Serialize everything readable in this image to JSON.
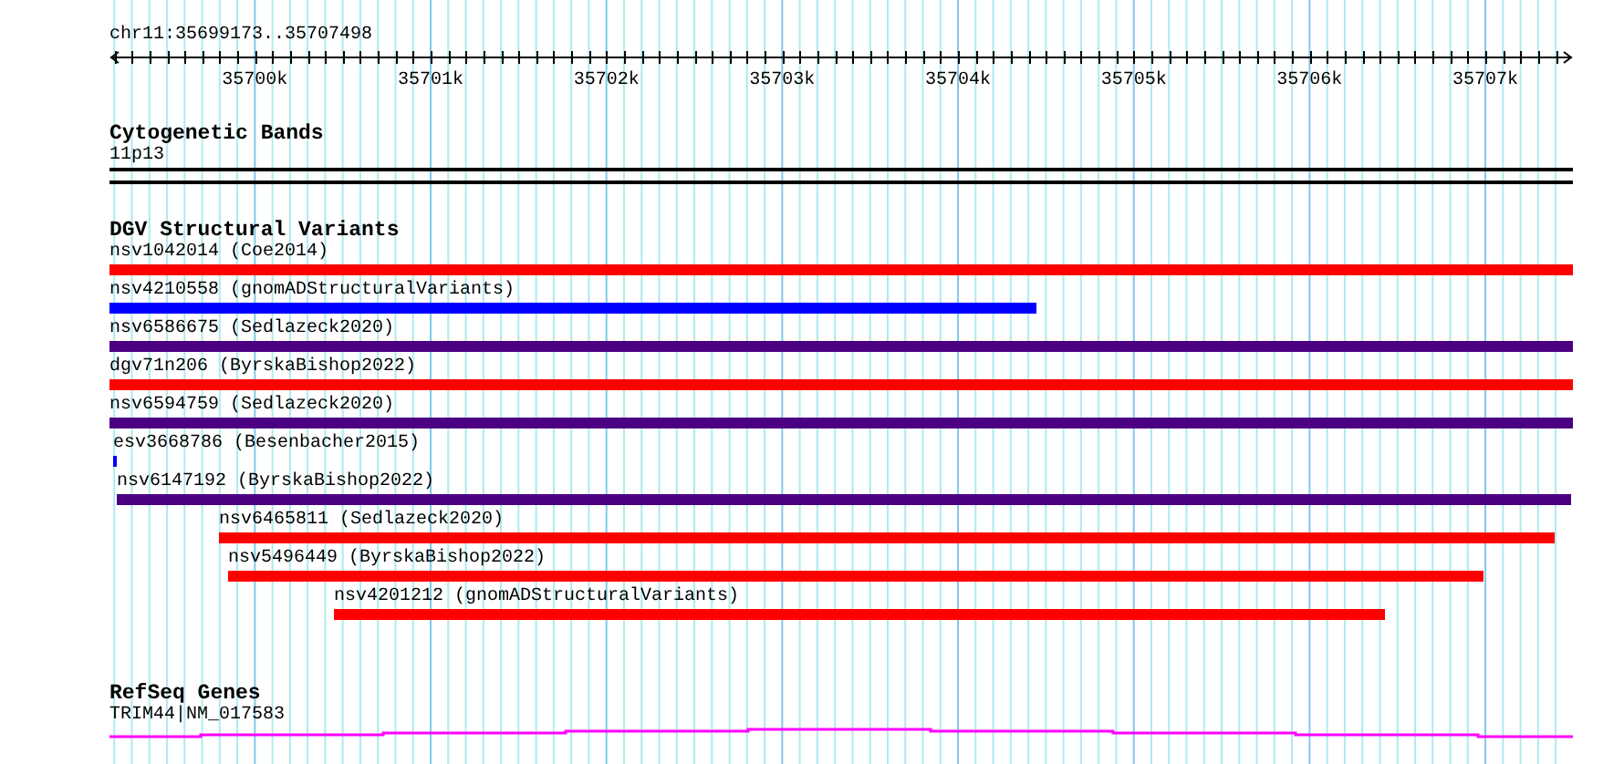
{
  "ruler": {
    "location": "chr11:35699173..35707498",
    "ticks": [
      "35700k",
      "35701k",
      "35702k",
      "35703k",
      "35704k",
      "35705k",
      "35706k",
      "35707k"
    ]
  },
  "tracks": [
    {
      "kind": "bands",
      "title": "Cytogenetic Bands",
      "features": [
        {
          "label": "11p13"
        }
      ]
    },
    {
      "kind": "variants",
      "title": "DGV Structural Variants",
      "features": [
        {
          "label": "nsv1042014 (Coe2014)",
          "color": "#ff0000"
        },
        {
          "label": "nsv4210558 (gnomADStructuralVariants)",
          "color": "#0000ff"
        },
        {
          "label": "nsv6586675 (Sedlazeck2020)",
          "color": "#4b0082"
        },
        {
          "label": "dgv71n206 (ByrskaBishop2022)",
          "color": "#ff0000"
        },
        {
          "label": "nsv6594759 (Sedlazeck2020)",
          "color": "#4b0082"
        },
        {
          "label": "esv3668786 (Besenbacher2015)",
          "color": "#0000ff"
        },
        {
          "label": "nsv6147192 (ByrskaBishop2022)",
          "color": "#4b0082"
        },
        {
          "label": "nsv6465811 (Sedlazeck2020)",
          "color": "#ff0000"
        },
        {
          "label": "nsv5496449 (ByrskaBishop2022)",
          "color": "#ff0000"
        },
        {
          "label": "nsv4201212 (gnomADStructuralVariants)",
          "color": "#ff0000"
        }
      ]
    },
    {
      "kind": "genes",
      "title": "RefSeq Genes",
      "features": [
        {
          "label": "TRIM44|NM_017583"
        }
      ]
    }
  ]
}
